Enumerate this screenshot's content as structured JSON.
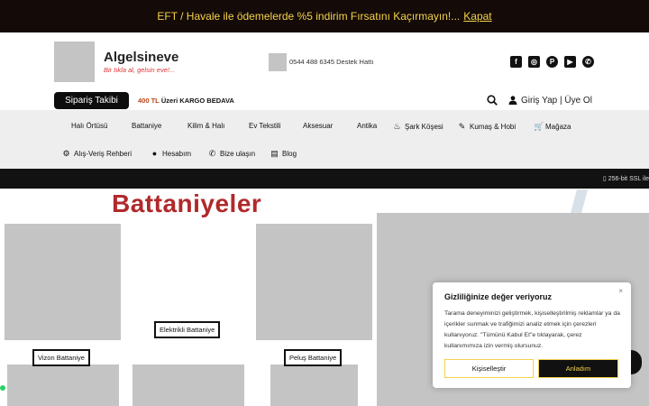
{
  "announcement": {
    "text": "EFT / Havale ile ödemelerde %5 indirim Fırsatını Kaçırmayın!...",
    "link": "Kapat",
    "text_color": "#f3d34a"
  },
  "header": {
    "brand": "Algelsineve",
    "slogan": "Bir tıkla al, gelsin eve!...",
    "phone": "0544 488 6345 Destek Hattı",
    "social_icons": [
      "facebook-icon",
      "instagram-icon",
      "pinterest-icon",
      "youtube-icon",
      "whatsapp-icon"
    ]
  },
  "toolbar": {
    "track_order": "Sipariş Takibi",
    "cargo_amount": "400 TL",
    "cargo_text": "Üzeri KARGO BEDAVA",
    "login": "Giriş Yap | Üye Ol"
  },
  "nav": {
    "items": [
      {
        "label": "Halı Örtüsü",
        "icon": ""
      },
      {
        "label": "Battaniye",
        "icon": ""
      },
      {
        "label": "Kilim & Halı",
        "icon": ""
      },
      {
        "label": "Ev Tekstili",
        "icon": ""
      },
      {
        "label": "Aksesuar",
        "icon": ""
      },
      {
        "label": "Antika",
        "icon": ""
      },
      {
        "label": "Şark Köşesi",
        "icon": "hookah-icon"
      },
      {
        "label": "Kumaş & Hobi",
        "icon": "pin-icon"
      },
      {
        "label": "Mağaza",
        "icon": "cart-icon"
      },
      {
        "label": "Alış-Veriş Rehberi",
        "icon": "gear-icon"
      },
      {
        "label": "Hesabım",
        "icon": "user-icon"
      },
      {
        "label": "Bize ulaşın",
        "icon": "whatsapp-icon"
      },
      {
        "label": "Blog",
        "icon": "blog-icon"
      }
    ]
  },
  "security": {
    "ssl": "256-bit SSL ile"
  },
  "page": {
    "title": "Battaniyeler",
    "title_color": "#b1292b",
    "categories": [
      "Elektrikli Battaniye",
      "Vizon Battaniye",
      "Peluş Battaniye"
    ]
  },
  "cookie": {
    "title": "Gizliliğinize değer veriyoruz",
    "text": "Tarama deneyiminizi geliştirmek, kişiselleştirilmiş reklamlar ya da içerikler sunmak ve trafiğimizi analiz etmek için çerezleri kullanıyoruz. \"Tümünü Kabul Et\"e tıklayarak, çerez kullanımımıza izin vermiş olursunuz.",
    "customize": "Kişiselleştir",
    "accept": "Anladım",
    "close": "×"
  }
}
